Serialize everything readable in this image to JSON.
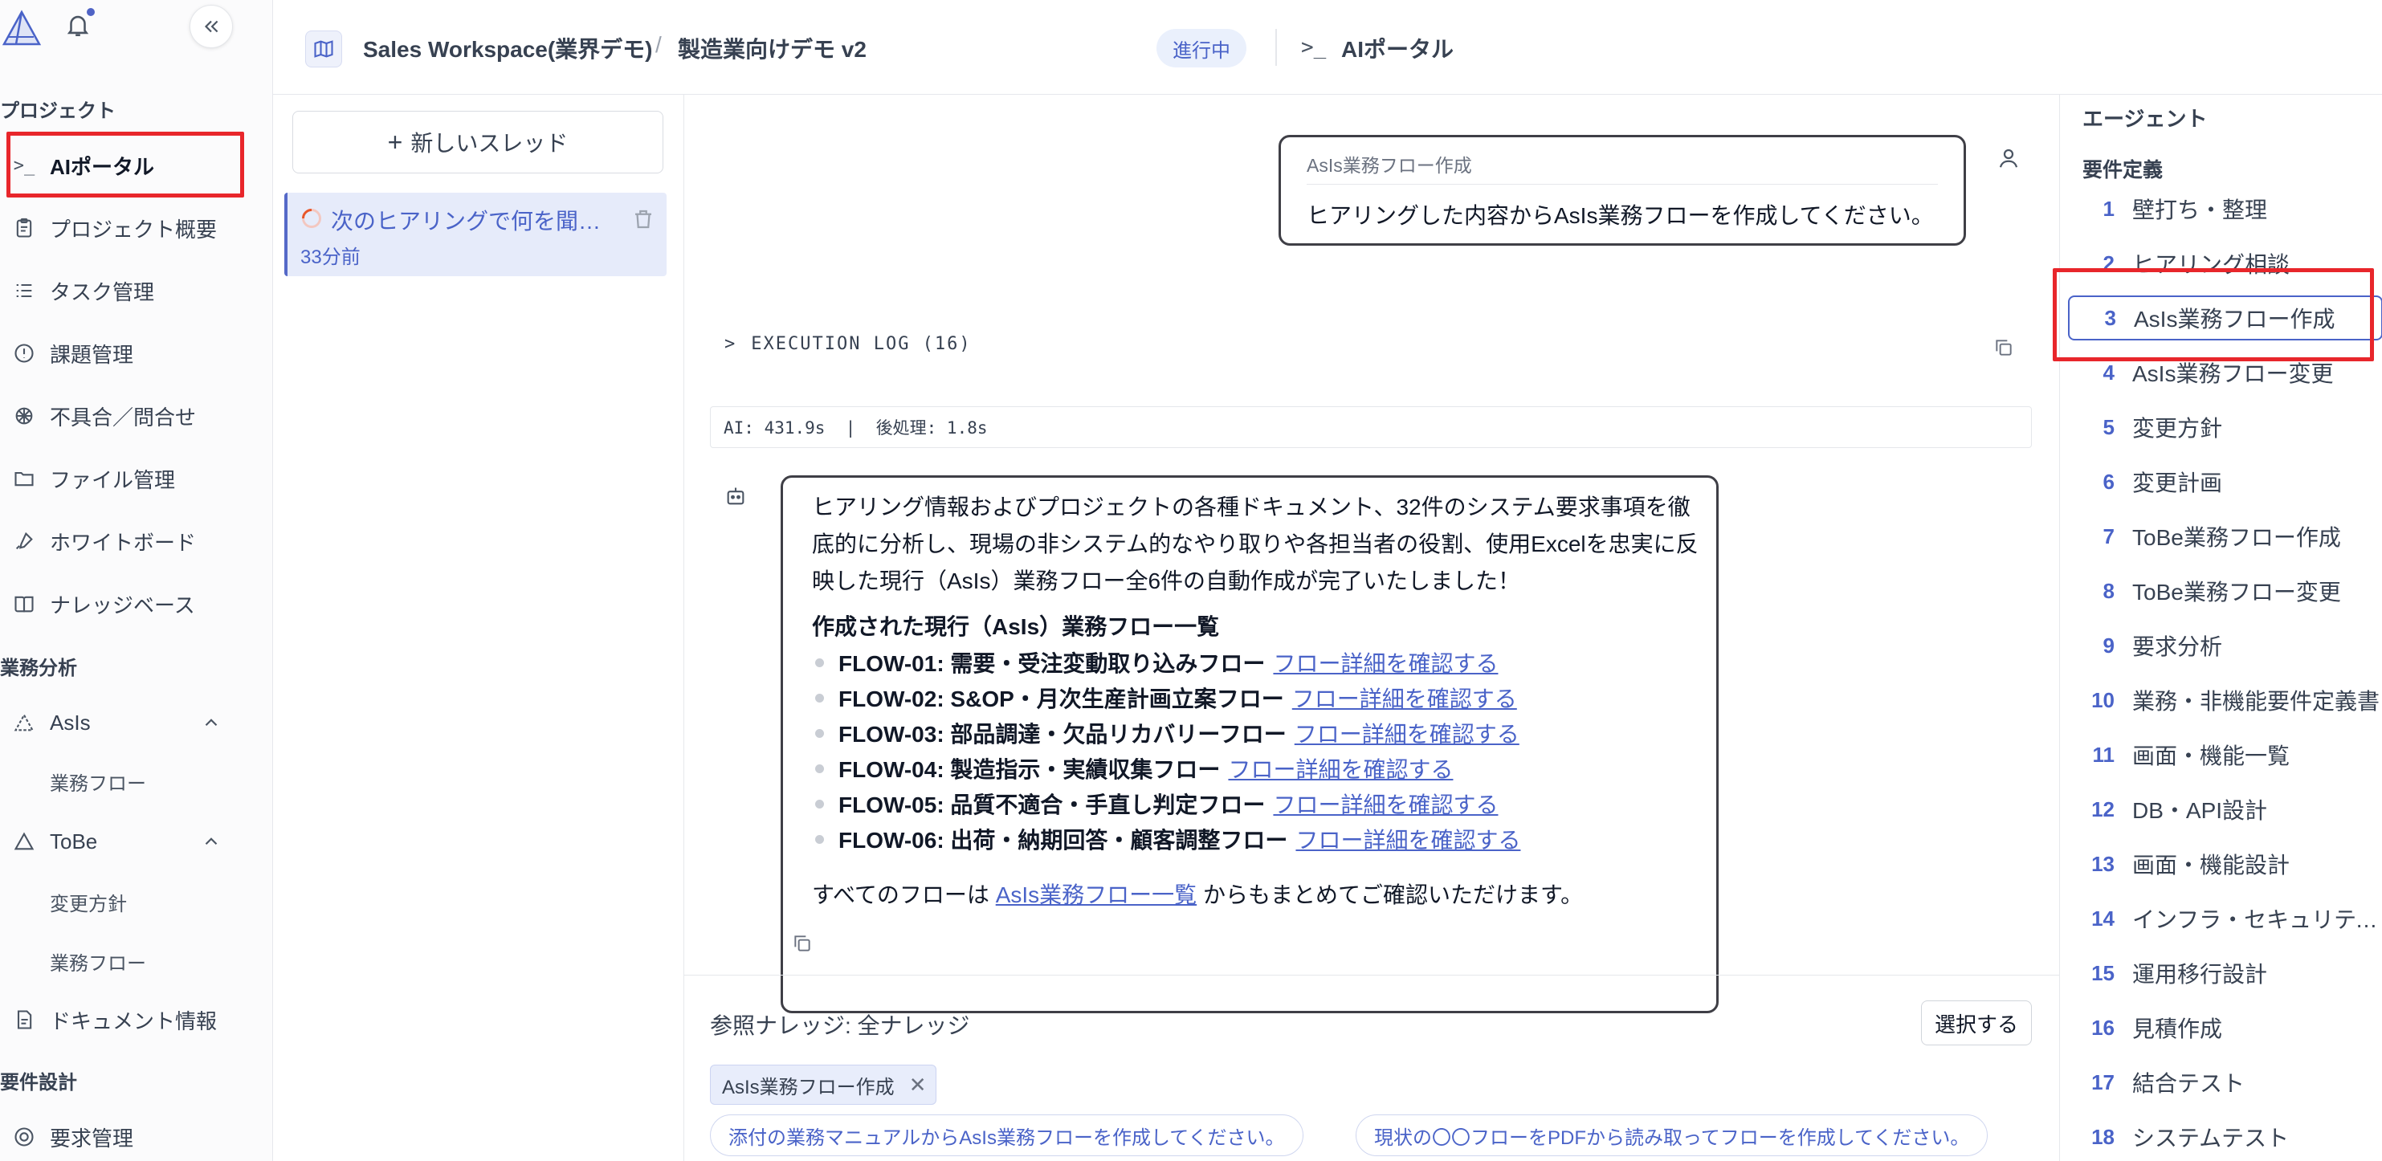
{
  "nav": {
    "sections": {
      "project": "プロジェクト",
      "analysis": "業務分析",
      "requirements": "要件設計"
    },
    "items": [
      {
        "label": "AIポータル",
        "icon": "terminal-icon"
      },
      {
        "label": "プロジェクト概要",
        "icon": "clipboard-icon"
      },
      {
        "label": "タスク管理",
        "icon": "list-icon"
      },
      {
        "label": "課題管理",
        "icon": "alert-circle-icon"
      },
      {
        "label": "不具合／問合せ",
        "icon": "bug-icon"
      },
      {
        "label": "ファイル管理",
        "icon": "folder-icon"
      },
      {
        "label": "ホワイトボード",
        "icon": "brush-icon"
      },
      {
        "label": "ナレッジベース",
        "icon": "book-icon"
      }
    ],
    "asis": {
      "label": "AsIs",
      "sub": [
        "業務フロー"
      ]
    },
    "tobe": {
      "label": "ToBe",
      "sub": [
        "変更方針",
        "業務フロー"
      ]
    },
    "doc": {
      "label": "ドキュメント情報"
    },
    "req": {
      "label": "要求管理"
    }
  },
  "header": {
    "workspace": "Sales Workspace(業界デモ)",
    "project": "製造業向けデモ v2",
    "status": "進行中",
    "page": "AIポータル"
  },
  "threads": {
    "new_label": "新しいスレッド",
    "items": [
      {
        "title": "次のヒアリングで何を聞くべきか",
        "time": "33分前"
      }
    ]
  },
  "chat": {
    "user_message": {
      "title": "AsIs業務フロー作成",
      "body": "ヒアリングした内容からAsIs業務フローを作成してください。"
    },
    "execution_log": "EXECUTION LOG (16)",
    "timing": "AI: 431.9s  |  後処理: 1.8s",
    "bot": {
      "intro": "ヒアリング情報およびプロジェクトの各種ドキュメント、32件のシステム要求事項を徹底的に分析し、現場の非システム的なやり取りや各担当者の役割、使用Excelを忠実に反映した現行（AsIs）業務フロー全6件の自動作成が完了いたしました！",
      "list_heading": "作成された現行（AsIs）業務フロー一覧",
      "flows": [
        {
          "name": "FLOW-01: 需要・受注変動取り込みフロー",
          "link": "フロー詳細を確認する"
        },
        {
          "name": "FLOW-02: S&OP・月次生産計画立案フロー",
          "link": "フロー詳細を確認する"
        },
        {
          "name": "FLOW-03: 部品調達・欠品リカバリーフロー",
          "link": "フロー詳細を確認する"
        },
        {
          "name": "FLOW-04: 製造指示・実績収集フロー",
          "link": "フロー詳細を確認する"
        },
        {
          "name": "FLOW-05: 品質不適合・手直し判定フロー",
          "link": "フロー詳細を確認する"
        },
        {
          "name": "FLOW-06: 出荷・納期回答・顧客調整フロー",
          "link": "フロー詳細を確認する"
        }
      ],
      "footer_pre": "すべてのフローは ",
      "footer_link": "AsIs業務フロー一覧",
      "footer_post": " からもまとめてご確認いただけます。"
    },
    "reference": {
      "label": "参照ナレッジ: 全ナレッジ",
      "select_label": "選択する",
      "chip": "AsIs業務フロー作成",
      "suggestions": [
        "添付の業務マニュアルからAsIs業務フローを作成してください。",
        "現状の〇〇フローをPDFから読み取ってフローを作成してください。"
      ]
    }
  },
  "agents": {
    "title": "エージェント",
    "section": "要件定義",
    "active_index": 2,
    "items": [
      {
        "num": "1",
        "label": "壁打ち・整理"
      },
      {
        "num": "2",
        "label": "ヒアリング相談"
      },
      {
        "num": "3",
        "label": "AsIs業務フロー作成"
      },
      {
        "num": "4",
        "label": "AsIs業務フロー変更"
      },
      {
        "num": "5",
        "label": "変更方針"
      },
      {
        "num": "6",
        "label": "変更計画"
      },
      {
        "num": "7",
        "label": "ToBe業務フロー作成"
      },
      {
        "num": "8",
        "label": "ToBe業務フロー変更"
      },
      {
        "num": "9",
        "label": "要求分析"
      },
      {
        "num": "10",
        "label": "業務・非機能要件定義書"
      },
      {
        "num": "11",
        "label": "画面・機能一覧"
      },
      {
        "num": "12",
        "label": "DB・API設計"
      },
      {
        "num": "13",
        "label": "画面・機能設計"
      },
      {
        "num": "14",
        "label": "インフラ・セキュリティ設計"
      },
      {
        "num": "15",
        "label": "運用移行設計"
      },
      {
        "num": "16",
        "label": "見積作成"
      },
      {
        "num": "17",
        "label": "結合テスト"
      },
      {
        "num": "18",
        "label": "システムテスト"
      }
    ]
  },
  "colors": {
    "accent": "#4a63c8",
    "highlight": "#e8262b",
    "active_bg": "#e6ebfa"
  }
}
